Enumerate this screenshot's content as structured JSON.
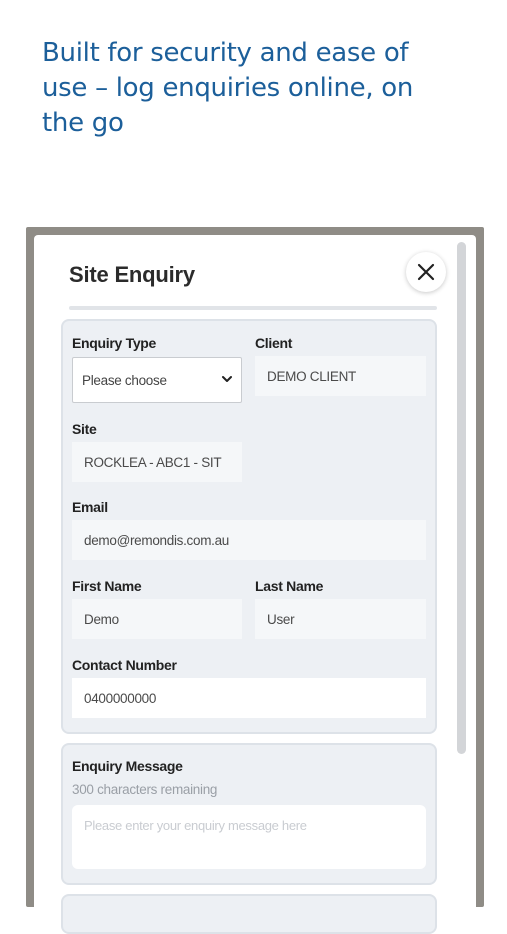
{
  "headline": "Built for security and ease of use – log enquiries online, on the go",
  "modal": {
    "title": "Site Enquiry",
    "close_icon": "close-icon"
  },
  "form": {
    "enquiry_type": {
      "label": "Enquiry Type",
      "value": "Please choose"
    },
    "client": {
      "label": "Client",
      "value": "DEMO CLIENT"
    },
    "site": {
      "label": "Site",
      "value": "ROCKLEA - ABC1 - SIT"
    },
    "email": {
      "label": "Email",
      "value": "demo@remondis.com.au"
    },
    "first_name": {
      "label": "First Name",
      "value": "Demo"
    },
    "last_name": {
      "label": "Last Name",
      "value": "User"
    },
    "contact_number": {
      "label": "Contact Number",
      "value": "0400000000"
    }
  },
  "message": {
    "label": "Enquiry Message",
    "remaining": "300 characters remaining",
    "placeholder": "Please enter your enquiry message here"
  },
  "colors": {
    "headline": "#1c5f9a",
    "panel": "#edf0f4",
    "frame": "#8f8c86"
  }
}
